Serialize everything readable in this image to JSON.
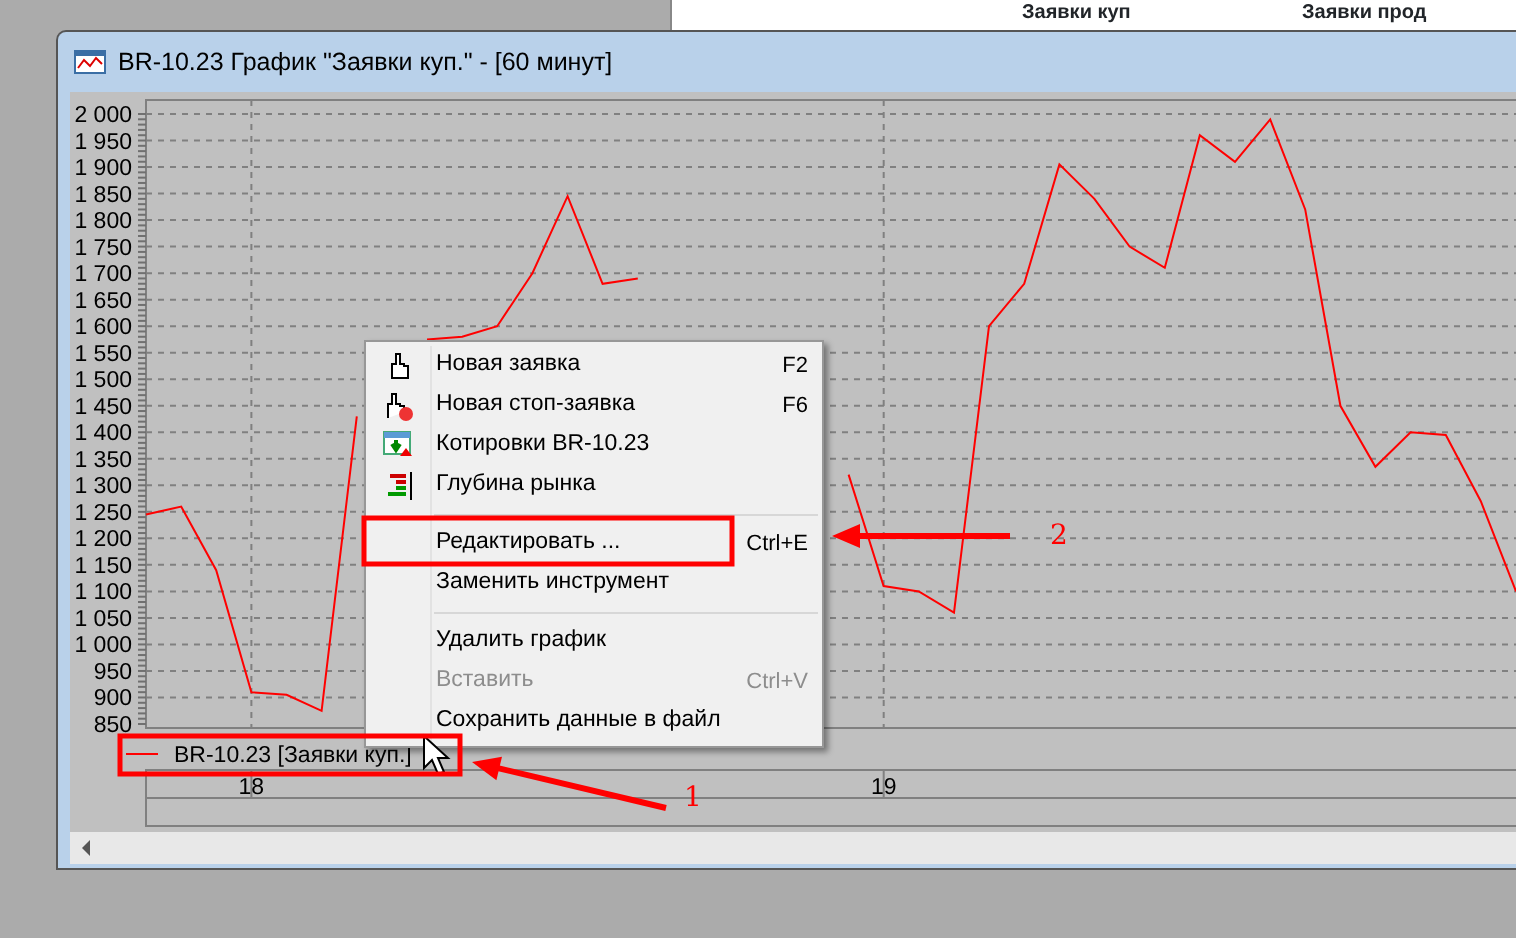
{
  "background_table": {
    "columns": [
      "Заявки куп",
      "Заявки прод"
    ]
  },
  "window": {
    "title": "BR-10.23 График \"Заявки куп.\" - [60 минут]"
  },
  "chart": {
    "chart_data": {
      "type": "line",
      "categories": [
        null,
        null,
        null,
        "18",
        null,
        null,
        null,
        null,
        null,
        null,
        null,
        null,
        null,
        null,
        null,
        null,
        null,
        null,
        null,
        null,
        null,
        "19",
        null,
        null,
        null,
        null,
        null,
        null,
        null,
        null,
        null,
        null,
        null,
        null,
        null,
        null,
        null,
        null,
        null,
        null
      ],
      "series": [
        {
          "name": "BR-10.23 [Заявки куп.]",
          "color": "#ff0000",
          "values": [
            1245,
            1260,
            1140,
            910,
            905,
            875,
            1430,
            null,
            1575,
            1580,
            1600,
            1700,
            1845,
            1680,
            1690,
            null,
            null,
            null,
            null,
            null,
            1320,
            1110,
            1100,
            1060,
            1600,
            1680,
            1905,
            1840,
            1750,
            1710,
            1960,
            1910,
            1990,
            1820,
            1450,
            1335,
            1400,
            1395,
            1270,
            1100
          ]
        }
      ],
      "ylim": [
        850,
        2000
      ],
      "grid": true,
      "yticks": [
        {
          "value": 2000,
          "label": "2 000"
        },
        {
          "value": 1950,
          "label": "1 950"
        },
        {
          "value": 1900,
          "label": "1 900"
        },
        {
          "value": 1850,
          "label": "1 850"
        },
        {
          "value": 1800,
          "label": "1 800"
        },
        {
          "value": 1750,
          "label": "1 750"
        },
        {
          "value": 1700,
          "label": "1 700"
        },
        {
          "value": 1650,
          "label": "1 650"
        },
        {
          "value": 1600,
          "label": "1 600"
        },
        {
          "value": 1550,
          "label": "1 550"
        },
        {
          "value": 1500,
          "label": "1 500"
        },
        {
          "value": 1450,
          "label": "1 450"
        },
        {
          "value": 1400,
          "label": "1 400"
        },
        {
          "value": 1350,
          "label": "1 350"
        },
        {
          "value": 1300,
          "label": "1 300"
        },
        {
          "value": 1250,
          "label": "1 250"
        },
        {
          "value": 1200,
          "label": "1 200"
        },
        {
          "value": 1150,
          "label": "1 150"
        },
        {
          "value": 1100,
          "label": "1 100"
        },
        {
          "value": 1050,
          "label": "1 050"
        },
        {
          "value": 1000,
          "label": "1 000"
        },
        {
          "value": 950,
          "label": "950"
        },
        {
          "value": 900,
          "label": "900"
        },
        {
          "value": 850,
          "label": "850"
        }
      ]
    }
  },
  "context_menu": {
    "items": [
      {
        "kind": "item",
        "label": "Новая заявка",
        "shortcut": "F2",
        "disabled": false
      },
      {
        "kind": "item",
        "label": "Новая стоп-заявка",
        "shortcut": "F6",
        "disabled": false
      },
      {
        "kind": "item",
        "label": "Котировки BR-10.23",
        "disabled": false
      },
      {
        "kind": "item",
        "label": "Глубина рынка",
        "disabled": false
      },
      {
        "kind": "separator"
      },
      {
        "kind": "item",
        "label": "Редактировать ...",
        "shortcut": "Ctrl+E",
        "disabled": false
      },
      {
        "kind": "item",
        "label": "Заменить инструмент",
        "disabled": false
      },
      {
        "kind": "separator"
      },
      {
        "kind": "item",
        "label": "Удалить график",
        "disabled": false
      },
      {
        "kind": "item",
        "label": "Вставить",
        "shortcut": "Ctrl+V",
        "disabled": true
      },
      {
        "kind": "item",
        "label": "Сохранить данные в файл",
        "disabled": false
      }
    ]
  },
  "callouts": [
    {
      "number": "1"
    },
    {
      "number": "2"
    }
  ]
}
